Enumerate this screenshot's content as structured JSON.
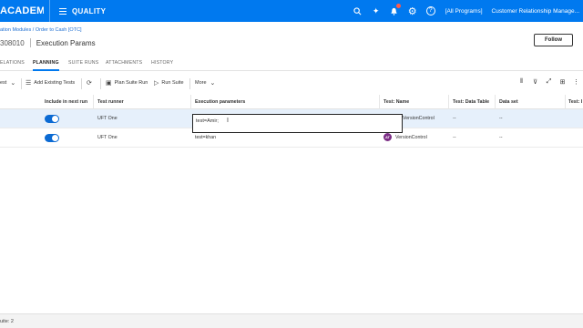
{
  "topbar": {
    "brand": "ACADEMY",
    "module": "QUALITY",
    "icons": [
      "search-icon",
      "pin-icon",
      "notifications-icon",
      "settings-icon",
      "help-icon"
    ],
    "programs": "[All Programs]",
    "workspace": "Customer Relationship Manage..."
  },
  "header": {
    "breadcrumb": "ation Modules / Order to Cash [OTC]",
    "id": "308010",
    "title": "Execution Params",
    "follow_label": "Follow"
  },
  "tabs": [
    {
      "label": "ELATIONS",
      "active": false
    },
    {
      "label": "PLANNING",
      "active": true
    },
    {
      "label": "SUITE RUNS",
      "active": false
    },
    {
      "label": "ATTACHMENTS",
      "active": false
    },
    {
      "label": "HISTORY",
      "active": false
    }
  ],
  "toolbar": {
    "filter_label": "est",
    "add_existing": "Add Existing Tests",
    "plan_suite_run": "Plan Suite Run",
    "run_suite": "Run Suite",
    "more": "More"
  },
  "grid": {
    "columns": [
      "Include in next run",
      "Test runner",
      "Execution parameters",
      "Test: Name",
      "Test: Data Table",
      "Data set",
      "Test: I"
    ],
    "rows": [
      {
        "include": true,
        "runner": "UFT One",
        "params": "test=Amir;",
        "name": "VersionControl",
        "data_table": "--",
        "data_set": "--",
        "selected": true
      },
      {
        "include": true,
        "runner": "UFT One",
        "params": "test=khan",
        "name": "VersionControl",
        "data_table": "--",
        "data_set": "--",
        "avatar": "AT",
        "selected": false
      }
    ]
  },
  "footer": {
    "count": "uite: 2"
  }
}
